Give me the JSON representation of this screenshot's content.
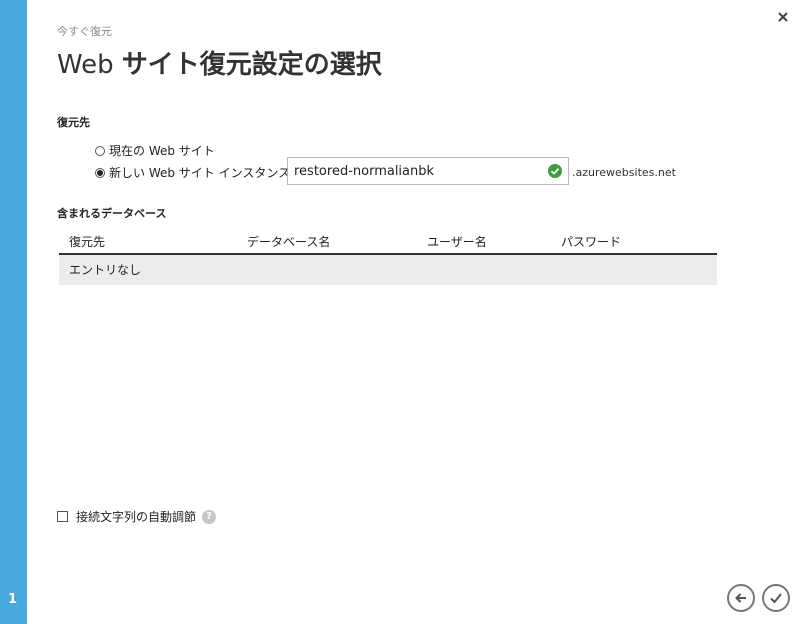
{
  "wizard": {
    "step_number": "1"
  },
  "header": {
    "breadcrumb": "今すぐ復元",
    "title_light": "Web",
    "title_bold": "サイト復元設定の選択"
  },
  "restore_target": {
    "label": "復元先",
    "options": [
      {
        "label": "現在の Web サイト",
        "checked": false
      },
      {
        "label": "新しい Web サイト インスタンス",
        "checked": true
      }
    ],
    "site_name_value": "restored-normalianbk",
    "domain_suffix": ".azurewebsites.net"
  },
  "databases": {
    "label": "含まれるデータベース",
    "columns": [
      "復元先",
      "データベース名",
      "ユーザー名",
      "パスワード"
    ],
    "empty_text": "エントリなし"
  },
  "auto_adjust": {
    "label": "接続文字列の自動調節",
    "checked": false
  },
  "colors": {
    "accent": "#49a9dc",
    "valid": "#3c9e3c"
  },
  "icons": {
    "close": "close-icon",
    "valid": "checkmark-valid-icon",
    "help": "help-icon",
    "back": "back-arrow-icon",
    "finish": "checkmark-icon"
  }
}
